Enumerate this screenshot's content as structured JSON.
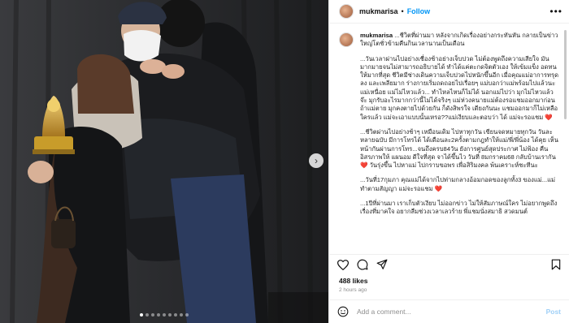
{
  "header": {
    "username": "mukmarisa",
    "separator": "•",
    "follow_label": "Follow",
    "more_icon": "more-horizontal-icon"
  },
  "caption": {
    "username": "mukmarisa",
    "paragraphs": [
      "...ชีวิตที่ผ่านมา หลังจากเกิดเรื่องอย่างกระทันหัน กลายเป็นข่าวใหญ่โตชั่วข้ามคืนกินเวลานานเป็นเดือน",
      "...วันเวลาผ่านไปอย่างเชื่องช้าอย่างเจ็บปวด ไม่ต้องพูดถึงความเสียใจ มันมากมายจนไม่สามารถอธิบายได้ ทำได้แค่ตะกดจิตตัวเอง ให้เข้มแข็ง อดทนให้มากที่สุด ชีวิตมีช่างเดินความเจ็บปวดไปหนักขึ้นอีก เมื่อคุณแม่อาการทรุดลง และเพลียมาก ร่างกายเริ่มถดถอยไปเรื่อยๆ แม่บอกว่าแม่พร้อมไปแล้วนะ แม่เหนื่อย แม่ไม่ไหวแล้ว... ทำไหลไหนก็ไม่ได้ นอกแม่ไปว่า มุกไม่ไหวแล้วจ๊ะ มุกรับอะไรมากกว่านี้ไม่ได้จริงๆ แม่ห่วงคนายแม่ต้องรอแชมออกมาก่อน ถ้าแม่ตาย มุกคงตายไปด้วยกัน ก็ดังสิพรใจ เดียงกันนะ แชมออกมาก็ไม่เหลือใครแล้ว แม่จะเอาแบบนั้นเหรอ??แม่เงียบและตอบว่า ได้ แม่จะรอแชม ❤️",
      "...ชีวิตผ่านไปอย่างช้าๆ เหมือนเดิม ไปหาทุกวัน เขียนจดหมายทุกวัน วันละหลายฉบับ มีการโทรได้ ได้เดือนละ2ครั้งตามกฎทำให้แม่/พี่/พี่น้อง ได้คุย เห็นหน้ากันผ่านการโทร...จนถึงครบ84วัน ยังการศูนย์สุดประกาศ ไม่ฟ้อง คืนอิสรภาพให้ แผนอม ดีใจที่สุด จาได้ขึ้นไว วันที่ 8มกราคม68 กลับบ้านเรากัน ❤️ วันรุ่งขึ้น ไปหาแม่ ไปกราบขอพร เพื่อสิริมงคล พ้นเคราะห์ชะทีนะ",
      "...วันที่17กุมภา คุณแม่ได้จากไปท่ามกลางอ้อมกอดของลูกทั้ง3 ของแม่...แม่ทำตามสัญญา แม่จะรอแชม ❤️",
      "...1ปีที่ผ่านมา เราเก็บตัวเงียบ ไม่ออกข่าว ไม่ให้สัมภาษณ์ใคร ไม่อยากพูดถึงเรื่องที่มาคใจ อยากลืมช่วงเวลาเลวร้าย พี่แชมนั่งสมาธิ สวดมนต์"
    ]
  },
  "actions": {
    "like_icon": "heart-icon",
    "comment_icon": "comment-icon",
    "share_icon": "share-icon",
    "save_icon": "bookmark-icon"
  },
  "likes_text": "488 likes",
  "timestamp": "2 hours ago",
  "comment": {
    "placeholder": "Add a comment...",
    "post_label": "Post",
    "emoji_icon": "emoji-icon"
  },
  "carousel": {
    "slide_count": 9,
    "active_index": 0,
    "next_icon": "chevron-right-icon"
  },
  "colors": {
    "follow": "#0095f6",
    "post_disabled": "#9fd0f7",
    "heart": "#ed4956"
  }
}
